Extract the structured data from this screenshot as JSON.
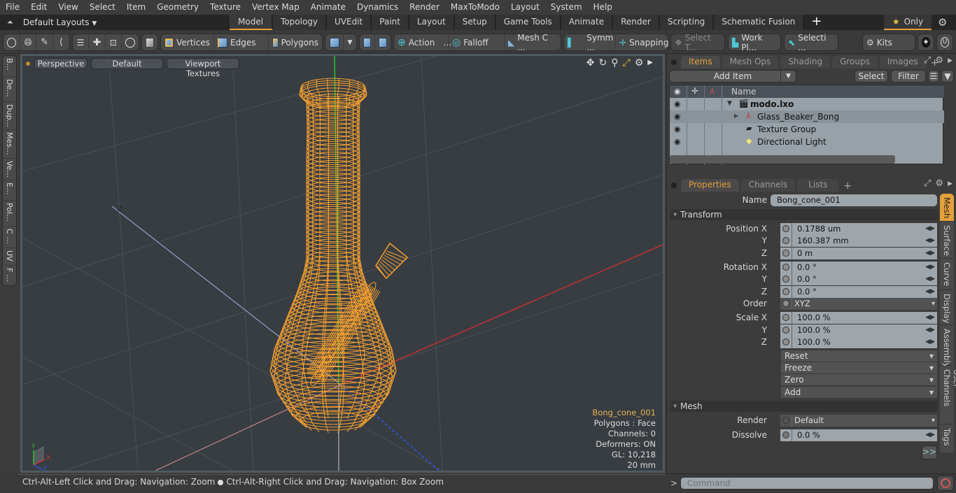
{
  "menu": [
    "File",
    "Edit",
    "View",
    "Select",
    "Item",
    "Geometry",
    "Texture",
    "Vertex Map",
    "Animate",
    "Dynamics",
    "Render",
    "MaxToModo",
    "Layout",
    "System",
    "Help"
  ],
  "layouts": {
    "selector_label": "Default Layouts",
    "tabs": [
      "Model",
      "Topology",
      "UVEdit",
      "Paint",
      "Layout",
      "Setup",
      "Game Tools",
      "Animate",
      "Render",
      "Scripting",
      "Schematic Fusion"
    ],
    "active_tab": "Model",
    "only_label": "Only"
  },
  "toolbar": {
    "vertices": "Vertices",
    "edges": "Edges",
    "polygons": "Polygons",
    "action": "Action",
    "falloff": "Falloff",
    "mesh_c": "Mesh C ...",
    "symm": "Symm ...",
    "snapping": "Snapping",
    "select_t": "Select T...",
    "work_pl": "Work Pl...",
    "selecti": "Selecti ...",
    "kits": "Kits"
  },
  "left_tabs": [
    "B...",
    "De...",
    "Dup...",
    "Mes...",
    "Ve...",
    "E...",
    "Pol...",
    "C ...",
    "UV",
    "F ..."
  ],
  "viewport": {
    "view_mode": "Perspective",
    "shading": "Default",
    "textures": "Viewport Textures",
    "info": {
      "selected": "Bong_cone_001",
      "polygons": "Polygons : Face",
      "channels": "Channels: 0",
      "deformers": "Deformers: ON",
      "gl": "GL: 10,218",
      "scale": "20 mm"
    },
    "axis_labels": {
      "y": "Y",
      "x": "X",
      "z": "Z"
    },
    "wire_color": "#f5a030"
  },
  "status": {
    "left": "Ctrl-Alt-Left Click and Drag: Navigation: Zoom",
    "right": "Ctrl-Alt-Right Click and Drag: Navigation: Box Zoom"
  },
  "items_panel": {
    "tabs": [
      "Items",
      "Mesh Ops",
      "Shading",
      "Groups",
      "Images"
    ],
    "active_tab": "Items",
    "add_item": "Add Item",
    "select": "Select",
    "filter": "Filter",
    "column_name": "Name",
    "rows": [
      {
        "name": "modo.lxo",
        "bold": true
      },
      {
        "name": "Glass_Beaker_Bong",
        "bold": false
      },
      {
        "name": "Texture Group",
        "bold": false
      },
      {
        "name": "Directional Light",
        "bold": false
      }
    ]
  },
  "properties": {
    "tabs": [
      "Properties",
      "Channels",
      "Lists"
    ],
    "active_tab": "Properties",
    "name_label": "Name",
    "name_value": "Bong_cone_001",
    "transform_section": "Transform",
    "position_label": "Position X",
    "rotation_label": "Rotation X",
    "scale_label": "Scale X",
    "order_label": "Order",
    "y_label": "Y",
    "z_label": "Z",
    "position": [
      "0.1788 um",
      "160.387 mm",
      "0 m"
    ],
    "rotation": [
      "0.0 °",
      "0.0 °",
      "0.0 °"
    ],
    "order": "XYZ",
    "scale": [
      "100.0 %",
      "100.0 %",
      "100.0 %"
    ],
    "actions": [
      "Reset",
      "Freeze",
      "Zero",
      "Add"
    ],
    "mesh_section": "Mesh",
    "render_label": "Render",
    "render_value": "Default",
    "dissolve_label": "Dissolve",
    "dissolve_value": "0.0 %",
    "more": ">>",
    "side_tabs": [
      "Mesh",
      "Surface",
      "Curve",
      "Display",
      "Assembly",
      "User Channels",
      "Tags"
    ],
    "active_side_tab": "Mesh"
  },
  "command": {
    "prompt": ">",
    "placeholder": "Command"
  },
  "colors": {
    "accent": "#e5a03a",
    "wire": "#f5a030"
  }
}
